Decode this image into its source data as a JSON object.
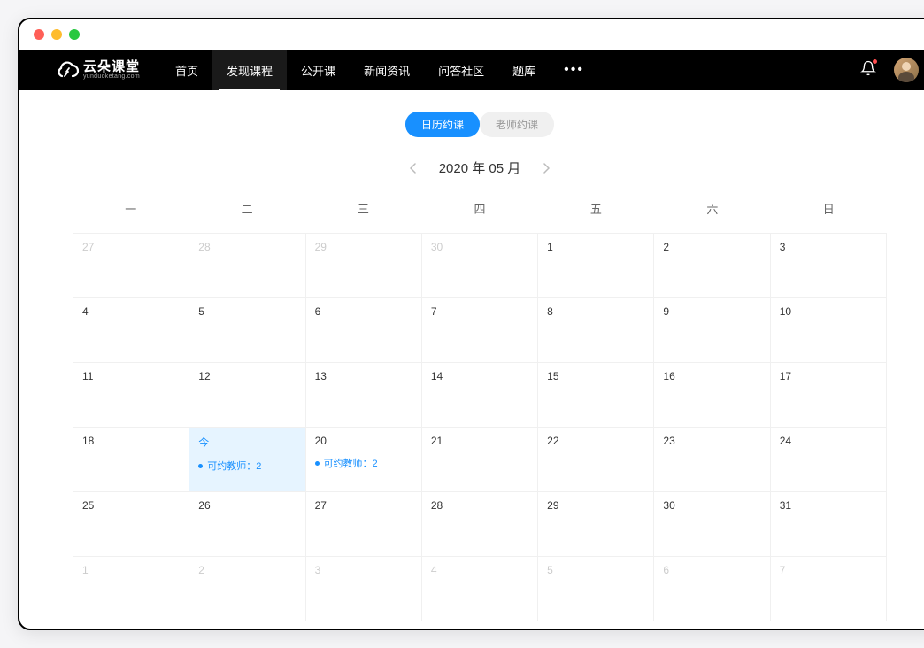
{
  "logo": {
    "cn": "云朵课堂",
    "en": "yunduoketang.com"
  },
  "nav": {
    "items": [
      "首页",
      "发现课程",
      "公开课",
      "新闻资讯",
      "问答社区",
      "题库"
    ],
    "activeIndex": 1
  },
  "tabs": {
    "calendar": "日历约课",
    "teacher": "老师约课"
  },
  "month": {
    "label": "2020 年 05 月"
  },
  "weekdays": [
    "一",
    "二",
    "三",
    "四",
    "五",
    "六",
    "日"
  ],
  "todayLabel": "今",
  "eventText": "可约教师：2",
  "days": [
    {
      "n": "27",
      "dim": true
    },
    {
      "n": "28",
      "dim": true
    },
    {
      "n": "29",
      "dim": true
    },
    {
      "n": "30",
      "dim": true
    },
    {
      "n": "1"
    },
    {
      "n": "2"
    },
    {
      "n": "3"
    },
    {
      "n": "4"
    },
    {
      "n": "5"
    },
    {
      "n": "6"
    },
    {
      "n": "7"
    },
    {
      "n": "8"
    },
    {
      "n": "9"
    },
    {
      "n": "10"
    },
    {
      "n": "11"
    },
    {
      "n": "12"
    },
    {
      "n": "13"
    },
    {
      "n": "14"
    },
    {
      "n": "15"
    },
    {
      "n": "16"
    },
    {
      "n": "17"
    },
    {
      "n": "18"
    },
    {
      "n": "今",
      "today": true,
      "event": true
    },
    {
      "n": "20",
      "event": true
    },
    {
      "n": "21"
    },
    {
      "n": "22"
    },
    {
      "n": "23"
    },
    {
      "n": "24"
    },
    {
      "n": "25"
    },
    {
      "n": "26"
    },
    {
      "n": "27"
    },
    {
      "n": "28"
    },
    {
      "n": "29"
    },
    {
      "n": "30"
    },
    {
      "n": "31"
    },
    {
      "n": "1",
      "dim": true
    },
    {
      "n": "2",
      "dim": true
    },
    {
      "n": "3",
      "dim": true
    },
    {
      "n": "4",
      "dim": true
    },
    {
      "n": "5",
      "dim": true
    },
    {
      "n": "6",
      "dim": true
    },
    {
      "n": "7",
      "dim": true
    }
  ]
}
